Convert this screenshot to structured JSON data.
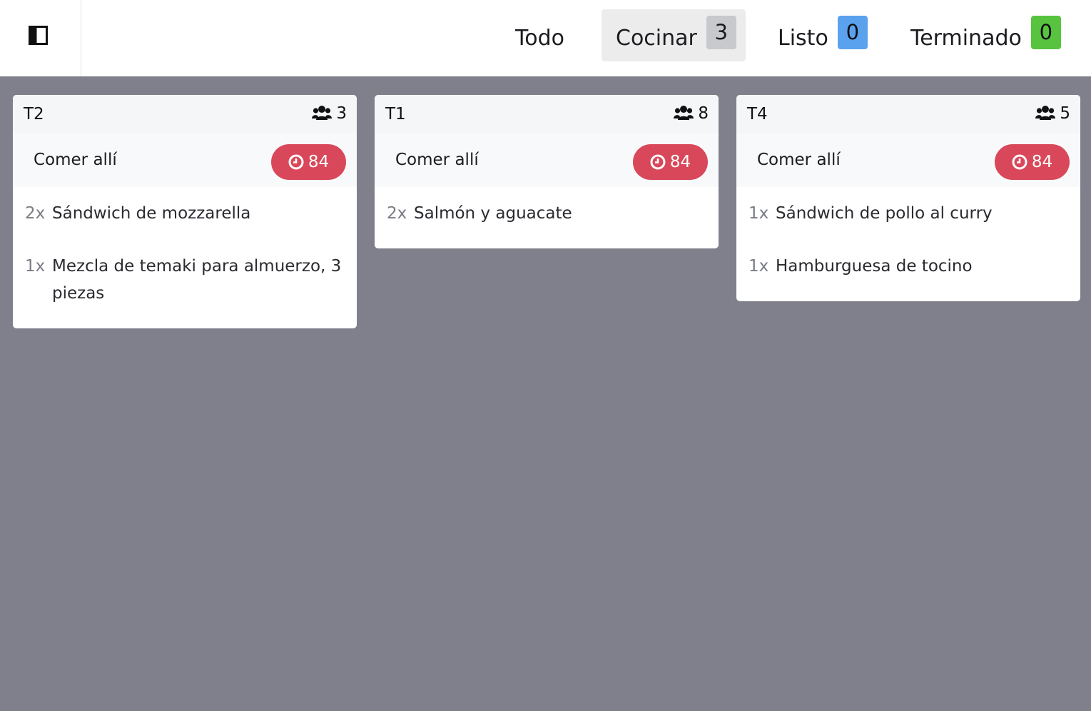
{
  "header": {
    "sidebar_toggle_icon": "sidebar-toggle-icon",
    "tabs": [
      {
        "label": "Todo",
        "count": null,
        "active": false
      },
      {
        "label": "Cocinar",
        "count": "3",
        "active": true,
        "count_color": "#c8c9cc"
      },
      {
        "label": "Listo",
        "count": "0",
        "active": false,
        "count_color": "#5aa2ee"
      },
      {
        "label": "Terminado",
        "count": "0",
        "active": false,
        "count_color": "#58c33f"
      }
    ]
  },
  "colors": {
    "board_background": "#7f808b",
    "timer_badge": "#d9485a"
  },
  "orders": [
    {
      "table": "T2",
      "guests": "3",
      "guests_icon": "users-icon",
      "order_type": "Comer allí",
      "timer_icon": "clock-icon",
      "timer": "84",
      "items": [
        {
          "qty": "2x",
          "name": "Sándwich de mozzarella"
        },
        {
          "qty": "1x",
          "name": "Mezcla de temaki para almuerzo, 3 piezas"
        }
      ]
    },
    {
      "table": "T1",
      "guests": "8",
      "guests_icon": "users-icon",
      "order_type": "Comer allí",
      "timer_icon": "clock-icon",
      "timer": "84",
      "items": [
        {
          "qty": "2x",
          "name": "Salmón y aguacate"
        }
      ]
    },
    {
      "table": "T4",
      "guests": "5",
      "guests_icon": "users-icon",
      "order_type": "Comer allí",
      "timer_icon": "clock-icon",
      "timer": "84",
      "items": [
        {
          "qty": "1x",
          "name": "Sándwich de pollo al curry"
        },
        {
          "qty": "1x",
          "name": "Hamburguesa de tocino"
        }
      ]
    }
  ]
}
